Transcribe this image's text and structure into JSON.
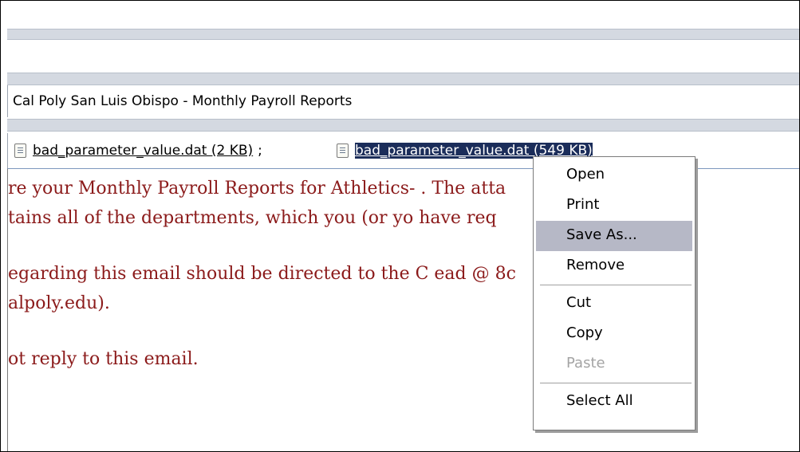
{
  "email": {
    "subject": "Cal Poly San Luis Obispo - Monthly Payroll Reports",
    "attachments": [
      {
        "name": "bad_parameter_value.dat (2 KB)",
        "separator": ";"
      },
      {
        "name": "bad_parameter_value.dat (549 KB)",
        "selected": true
      }
    ],
    "body_lines": [
      "re your Monthly Payroll Reports for Athletics-                .  The atta",
      "tains all of the departments, which you (or yo                  have req",
      "egarding this email should be directed to the C                 ead @ 8c",
      "alpoly.edu).",
      "ot reply to this email."
    ]
  },
  "context_menu": {
    "items": [
      {
        "label": "Open",
        "state": "normal"
      },
      {
        "label": "Print",
        "state": "normal"
      },
      {
        "label": "Save As...",
        "state": "hover"
      },
      {
        "label": "Remove",
        "state": "normal"
      },
      {
        "label": "Cut",
        "state": "normal"
      },
      {
        "label": "Copy",
        "state": "normal"
      },
      {
        "label": "Paste",
        "state": "disabled"
      },
      {
        "label": "Select All",
        "state": "normal"
      }
    ]
  },
  "colors": {
    "body_text": "#8b1a1a",
    "selection_bg": "#1b2d5a",
    "menu_hover": "#b6b8c6"
  }
}
